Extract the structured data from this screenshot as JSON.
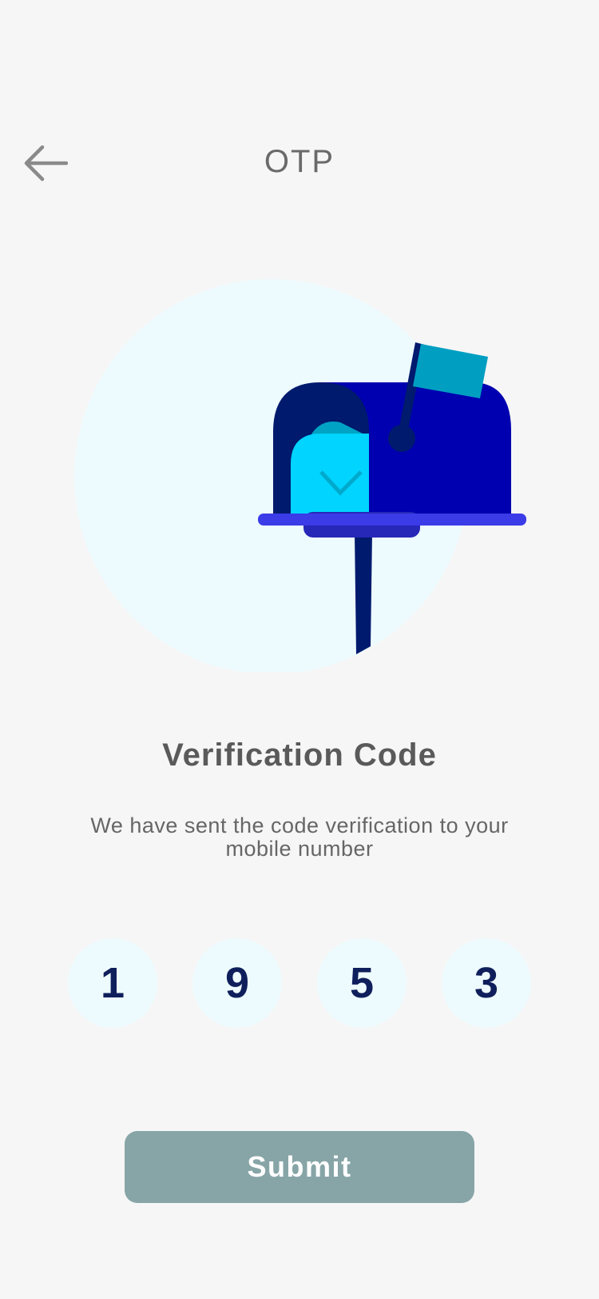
{
  "header": {
    "title": "OTP",
    "back_icon": "arrow-left-icon"
  },
  "illustration": {
    "icon": "mailbox-illustration",
    "colors": {
      "circle_bg": "#eefbfe",
      "mailbox_body": "#0000b0",
      "mailbox_door": "#001a6e",
      "letter": "#00d4ff",
      "flag": "#009fc2",
      "base": "#3b3be8",
      "post": "#001a6e"
    }
  },
  "content": {
    "heading": "Verification Code",
    "subtitle": "We have sent the code verification to your mobile number"
  },
  "otp": {
    "digits": [
      "1",
      "9",
      "5",
      "3"
    ]
  },
  "actions": {
    "submit_label": "Submit"
  },
  "colors": {
    "background": "#f6f6f6",
    "digit_text": "#0f1f5c",
    "button_bg": "#87a5a7"
  }
}
